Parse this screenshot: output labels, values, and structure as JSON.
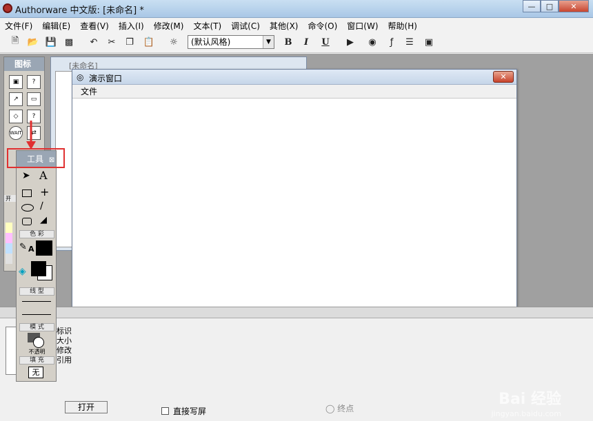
{
  "window": {
    "title": "Authorware 中文版: [未命名] *"
  },
  "menubar": {
    "items": [
      "文件(F)",
      "编辑(E)",
      "查看(V)",
      "插入(I)",
      "修改(M)",
      "文本(T)",
      "调试(C)",
      "其他(X)",
      "命令(O)",
      "窗口(W)",
      "帮助(H)"
    ]
  },
  "toolbar": {
    "style_select": "(默认风格)",
    "bold": "B",
    "italic": "I",
    "underline": "U"
  },
  "icons_palette": {
    "title": "图标"
  },
  "flow_window": {
    "title": "[未命名]"
  },
  "demo_window": {
    "title": "演示窗口",
    "menu_file": "文件"
  },
  "tools_palette": {
    "title": "工具",
    "color_label": "色 彩",
    "line_label": "线 型",
    "mode_label": "模 式",
    "mode_value": "不透明",
    "fill_label": "填 充",
    "fill_value": "无",
    "text_tool": "A",
    "pen_label": "A"
  },
  "props": {
    "label_id": "标识",
    "label_size": "大小",
    "label_modify": "修改",
    "label_ref": "引用",
    "open_button": "打开",
    "direct_write": "直接写屏",
    "end_point": "终点"
  },
  "watermark": {
    "brand": "Bai 经验",
    "url": "jingyan.baidu.com"
  },
  "colors": {
    "red_highlight": "#e03030",
    "palette_head": "#9aa6b4"
  }
}
